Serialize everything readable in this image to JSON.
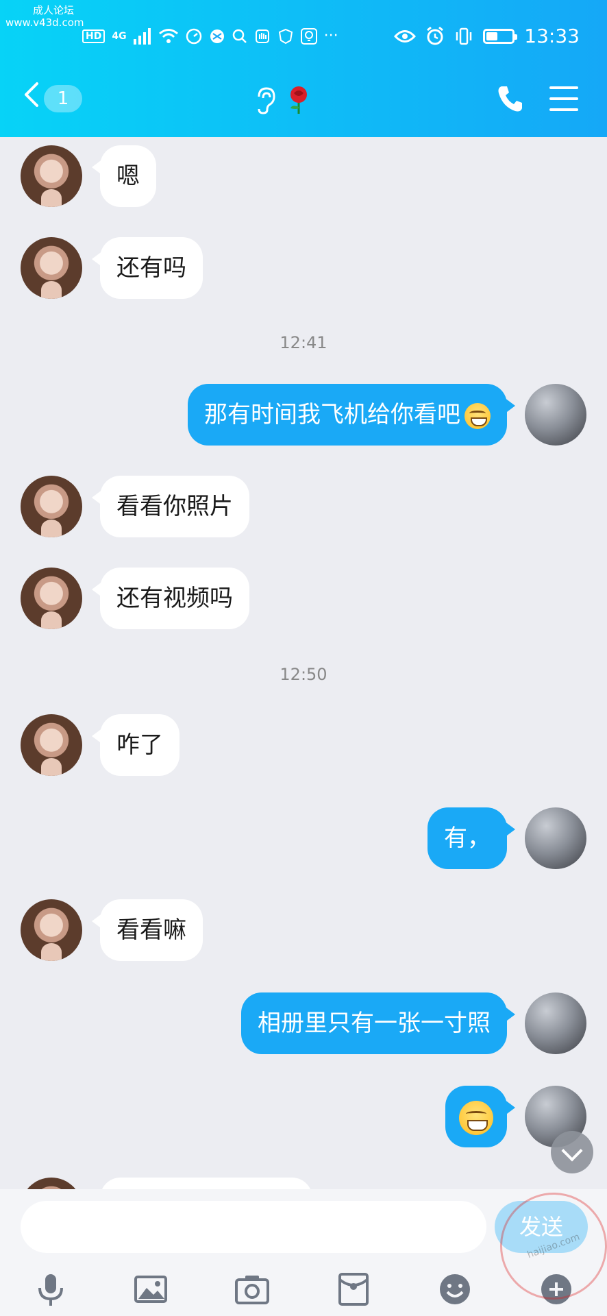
{
  "watermark": {
    "line1": "成人论坛",
    "line2": "www.v43d.com",
    "badge": "haijiao.com"
  },
  "status_bar": {
    "left_tags": [
      "HD",
      "4G"
    ],
    "left_icons": [
      "signal-icon",
      "wifi-icon",
      "speed-icon",
      "browser-icon",
      "search-icon",
      "hand-icon",
      "shield-icon",
      "bulb-icon",
      "more-icon"
    ],
    "right_icons": [
      "eye-icon",
      "alarm-icon",
      "vibrate-icon",
      "battery-icon"
    ],
    "battery_level": 0.4,
    "time": "13:33"
  },
  "header": {
    "back_badge": "1",
    "ear_icon": "👂",
    "rose": "🌹",
    "icons": [
      "back-icon",
      "phone-icon",
      "menu-icon"
    ],
    "accent": "#15a8f7"
  },
  "messages": [
    {
      "side": "in",
      "text": "嗯"
    },
    {
      "side": "in",
      "text": "还有吗"
    },
    {
      "side": "time",
      "text": "12:41"
    },
    {
      "side": "out",
      "text": "那有时间我飞机给你看吧"
    },
    {
      "side": "in",
      "text": "看看你照片"
    },
    {
      "side": "in",
      "text": "还有视频吗"
    },
    {
      "side": "time",
      "text": "12:50"
    },
    {
      "side": "in",
      "text": "咋了"
    },
    {
      "side": "out",
      "text": "有，"
    },
    {
      "side": "in",
      "text": "看看嘛"
    },
    {
      "side": "out",
      "text": "相册里只有一张一寸照"
    },
    {
      "side": "out",
      "text": ""
    }
  ],
  "input": {
    "placeholder": "",
    "send_label": "发送"
  },
  "toolbar": [
    "mic-icon",
    "image-icon",
    "camera-icon",
    "red-packet-icon",
    "emoji-icon",
    "plus-icon"
  ]
}
